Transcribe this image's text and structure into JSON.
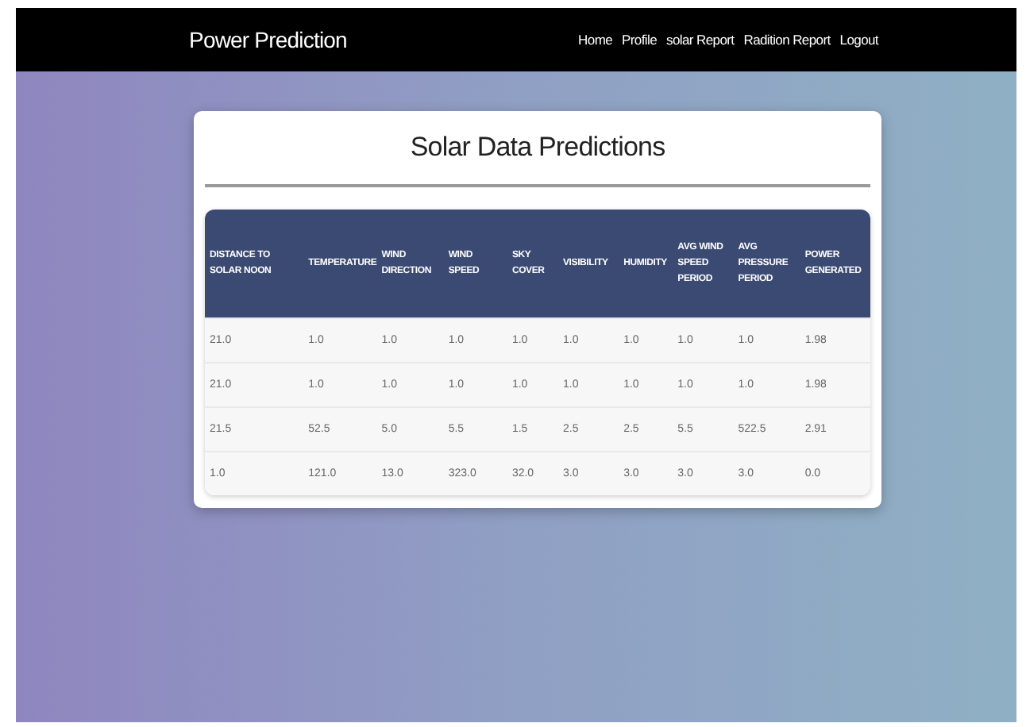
{
  "navbar": {
    "brand": "Power Prediction",
    "links": [
      "Home",
      "Profile",
      "solar Report",
      "Radition Report",
      "Logout"
    ]
  },
  "card": {
    "title": "Solar Data Predictions"
  },
  "table": {
    "columns": [
      "DISTANCE TO SOLAR NOON",
      "TEMPERATURE",
      "WIND DIRECTION",
      "WIND SPEED",
      "SKY COVER",
      "VISIBILITY",
      "HUMIDITY",
      "AVG WIND SPEED PERIOD",
      "AVG PRESSURE PERIOD",
      "POWER GENERATED"
    ],
    "rows": [
      [
        "21.0",
        "1.0",
        "1.0",
        "1.0",
        "1.0",
        "1.0",
        "1.0",
        "1.0",
        "1.0",
        "1.98"
      ],
      [
        "21.0",
        "1.0",
        "1.0",
        "1.0",
        "1.0",
        "1.0",
        "1.0",
        "1.0",
        "1.0",
        "1.98"
      ],
      [
        "21.5",
        "52.5",
        "5.0",
        "5.5",
        "1.5",
        "2.5",
        "2.5",
        "5.5",
        "522.5",
        "2.91"
      ],
      [
        "1.0",
        "121.0",
        "13.0",
        "323.0",
        "32.0",
        "3.0",
        "3.0",
        "3.0",
        "3.0",
        "0.0"
      ]
    ]
  }
}
